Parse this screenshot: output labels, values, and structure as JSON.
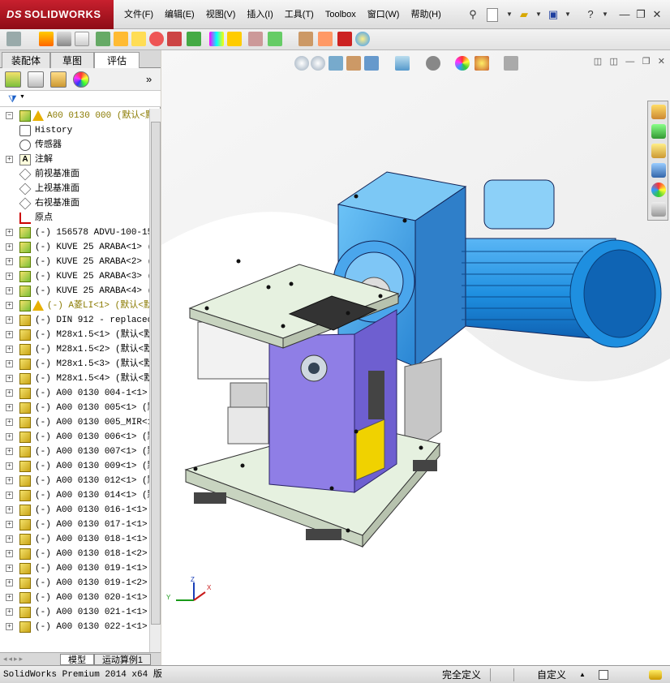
{
  "app": {
    "brand_ds": "DS",
    "brand": "SOLIDWORKS"
  },
  "menu": [
    "文件(F)",
    "编辑(E)",
    "视图(V)",
    "插入(I)",
    "工具(T)",
    "Toolbox",
    "窗口(W)",
    "帮助(H)"
  ],
  "window_controls": {
    "help": "?",
    "minimize": "—",
    "restore": "❐",
    "close": "✕"
  },
  "panel_tabs": [
    "装配体",
    "草图",
    "评估"
  ],
  "panel_tab_active": 2,
  "collapse_glyph": "»",
  "tree": [
    {
      "text": "A00 0130 000 (默认<默认",
      "icon": "asm",
      "warn": true,
      "color": "yellow",
      "root": true
    },
    {
      "text": "History",
      "icon": "hist"
    },
    {
      "text": "传感器",
      "icon": "sens"
    },
    {
      "text": "注解",
      "icon": "ann",
      "plus": true
    },
    {
      "text": "前视基准面",
      "icon": "plane"
    },
    {
      "text": "上视基准面",
      "icon": "plane"
    },
    {
      "text": "右视基准面",
      "icon": "plane"
    },
    {
      "text": "原点",
      "icon": "orig"
    },
    {
      "text": "(-) 156578 ADVU-100-15-",
      "icon": "asm",
      "plus": true
    },
    {
      "text": "(-) KUVE 25 ARABA<1> (默",
      "icon": "asm",
      "plus": true
    },
    {
      "text": "(-) KUVE 25 ARABA<2> (默",
      "icon": "asm",
      "plus": true
    },
    {
      "text": "(-) KUVE 25 ARABA<3> (默",
      "icon": "asm",
      "plus": true
    },
    {
      "text": "(-) KUVE 25 ARABA<4> (默",
      "icon": "asm",
      "plus": true
    },
    {
      "text": "(-) A菱LI<1> (默认<默",
      "icon": "asm",
      "plus": true,
      "warn": true,
      "color": "yellow"
    },
    {
      "text": "(-) DIN 912 - replaced",
      "icon": "part",
      "plus": true
    },
    {
      "text": "(-) M28x1.5<1> (默认<默",
      "icon": "part",
      "plus": true
    },
    {
      "text": "(-) M28x1.5<2> (默认<默",
      "icon": "part",
      "plus": true
    },
    {
      "text": "(-) M28x1.5<3> (默认<默",
      "icon": "part",
      "plus": true
    },
    {
      "text": "(-) M28x1.5<4> (默认<默",
      "icon": "part",
      "plus": true
    },
    {
      "text": "(-) A00 0130 004-1<1> (",
      "icon": "part",
      "plus": true
    },
    {
      "text": "(-) A00 0130 005<1> (默",
      "icon": "part",
      "plus": true
    },
    {
      "text": "(-) A00 0130 005_MIR<1>",
      "icon": "part",
      "plus": true
    },
    {
      "text": "(-) A00 0130 006<1> (默",
      "icon": "part",
      "plus": true
    },
    {
      "text": "(-) A00 0130 007<1> (默",
      "icon": "part",
      "plus": true
    },
    {
      "text": "(-) A00 0130 009<1> (默",
      "icon": "part",
      "plus": true
    },
    {
      "text": "(-) A00 0130 012<1> (默",
      "icon": "part",
      "plus": true
    },
    {
      "text": "(-) A00 0130 014<1> (默",
      "icon": "part",
      "plus": true
    },
    {
      "text": "(-) A00 0130 016-1<1> (",
      "icon": "part",
      "plus": true
    },
    {
      "text": "(-) A00 0130 017-1<1> (",
      "icon": "part",
      "plus": true
    },
    {
      "text": "(-) A00 0130 018-1<1> (",
      "icon": "part",
      "plus": true
    },
    {
      "text": "(-) A00 0130 018-1<2> (",
      "icon": "part",
      "plus": true
    },
    {
      "text": "(-) A00 0130 019-1<1> (",
      "icon": "part",
      "plus": true
    },
    {
      "text": "(-) A00 0130 019-1<2> (",
      "icon": "part",
      "plus": true
    },
    {
      "text": "(-) A00 0130 020-1<1> (",
      "icon": "part",
      "plus": true
    },
    {
      "text": "(-) A00 0130 021-1<1> (",
      "icon": "part",
      "plus": true
    },
    {
      "text": "(-) A00 0130 022-1<1> (",
      "icon": "part",
      "plus": true
    }
  ],
  "bottom_tabs": [
    "模型",
    "运动算例1"
  ],
  "triad": {
    "x": "X",
    "y": "Y",
    "z": "Z"
  },
  "status": {
    "product": "SolidWorks Premium 2014 x64 版",
    "state": "完全定义",
    "units": "自定义",
    "units_arrow": "▲"
  },
  "colors": {
    "brand_red": "#b5121b",
    "motor_blue": "#1e8fe0",
    "plate_green": "#e6f1e0",
    "panel_purple": "#8f7ee6"
  }
}
